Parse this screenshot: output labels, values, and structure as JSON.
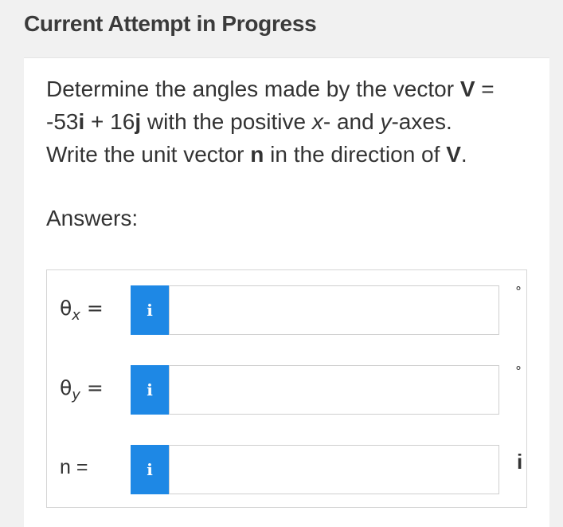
{
  "header": {
    "title": "Current Attempt in Progress"
  },
  "question": {
    "line1_prefix": "Determine the angles made by the vector ",
    "vector_symbol": "V",
    "line1_suffix": " =",
    "line2_expr_a": "-53",
    "unit_i": "i",
    "line2_expr_b": " + 16",
    "unit_j": "j",
    "line2_mid": " with the positive ",
    "x_axis": "x",
    "line2_and": "- and ",
    "y_axis": "y",
    "line2_end": "-axes.",
    "line3_prefix": "Write the unit vector ",
    "unit_vector_symbol": "n",
    "line3_mid": " in the direction of ",
    "line3_vector": "V",
    "line3_end": "."
  },
  "answers": {
    "label": "Answers:",
    "rows": [
      {
        "label_main": "θ",
        "label_sub": "x",
        "label_eq": " =",
        "info_icon": "i",
        "input_value": "",
        "unit": "°"
      },
      {
        "label_main": "θ",
        "label_sub": "y",
        "label_eq": " =",
        "info_icon": "i",
        "input_value": "",
        "unit": "°"
      },
      {
        "label_main": "n",
        "label_sub": "",
        "label_eq": " =",
        "info_icon": "i",
        "input_value": "",
        "unit": "i"
      }
    ]
  },
  "colors": {
    "info_button_bg": "#1e88e5",
    "background": "#f1f1f1",
    "card": "#ffffff",
    "text": "#333333"
  }
}
